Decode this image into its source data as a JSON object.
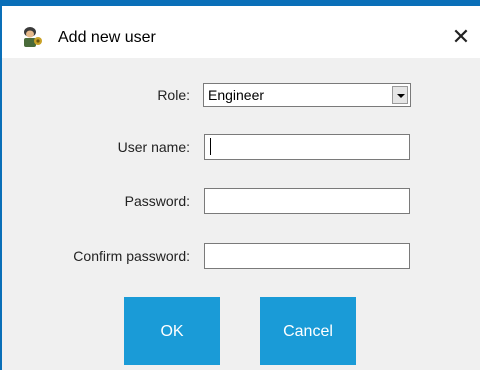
{
  "window": {
    "title": "Add new user",
    "close_glyph": "✕",
    "icon": "user-admin-icon"
  },
  "form": {
    "role_label": "Role:",
    "role_value": "Engineer",
    "username_label": "User name:",
    "username_value": "",
    "password_label": "Password:",
    "password_value": "",
    "confirm_label": "Confirm password:",
    "confirm_value": ""
  },
  "buttons": {
    "ok_label": "OK",
    "cancel_label": "Cancel"
  },
  "colors": {
    "accent": "#1a9bd7",
    "frame": "#0a6fb8",
    "dialog_bg": "#f0f0f0"
  }
}
